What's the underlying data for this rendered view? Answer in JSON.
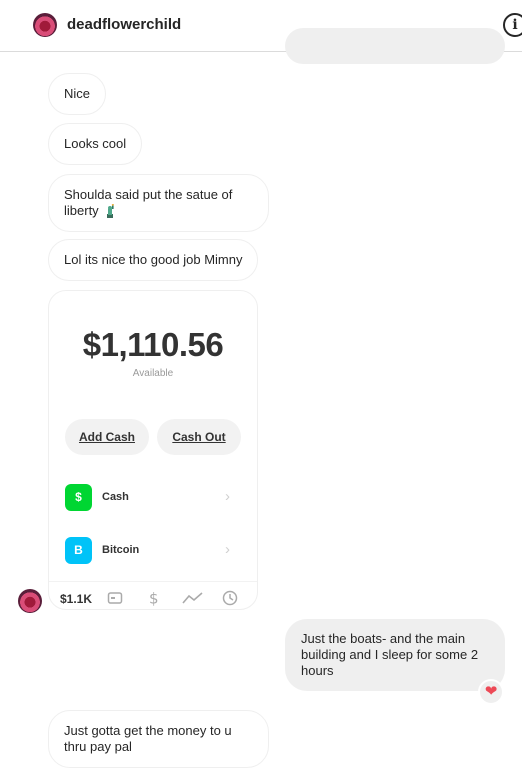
{
  "header": {
    "username": "deadflowerchild",
    "info_icon": "i"
  },
  "messages": {
    "m1": "Nice",
    "m2": "Looks cool",
    "m3": "Shoulda said put the satue of liberty",
    "m4": "Lol its nice tho good job Mimny",
    "m5": "Just the boats- and the main building and I sleep for some 2 hours",
    "m6": "Just gotta get the money to u thru pay pal"
  },
  "cash_card": {
    "balance": "$1,110.56",
    "available_label": "Available",
    "add_cash_label": "Add Cash",
    "cash_out_label": "Cash Out",
    "accounts": [
      {
        "icon_text": "$",
        "label": "Cash",
        "color": "#00d632"
      },
      {
        "icon_text": "B",
        "label": "Bitcoin",
        "color": "#00c3f8"
      }
    ],
    "tab_amount": "$1.1K"
  },
  "reaction": {
    "emoji": "❤"
  },
  "colors": {
    "bubble_out": "#efefef",
    "bubble_in_border": "#efefef",
    "cash_green": "#00d632",
    "bitcoin_blue": "#00c3f8",
    "heart": "#ed4956"
  }
}
